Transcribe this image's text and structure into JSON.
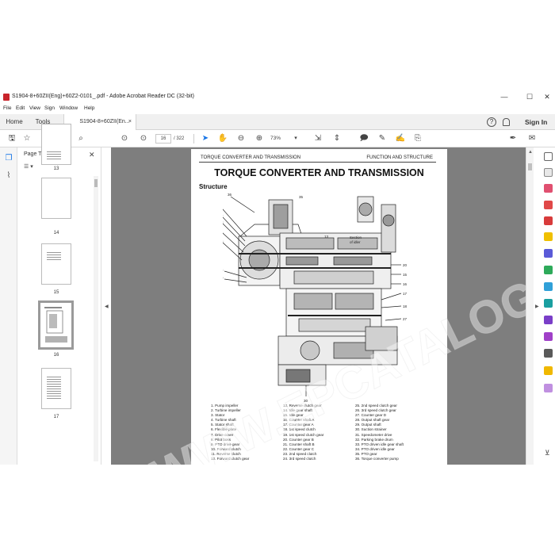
{
  "window": {
    "title": "S1904-8+60ZII(Eng)+60Z2-0101_.pdf - Adobe Acrobat Reader DC (32-bit)",
    "minimize": "—",
    "maximize": "☐",
    "close": "✕"
  },
  "menu": [
    "File",
    "Edit",
    "View",
    "Sign",
    "Window",
    "Help"
  ],
  "tabs": {
    "home": "Home",
    "tools": "Tools",
    "doc": "S1904-8+60ZII(En...",
    "doc_close": "×"
  },
  "header_right": {
    "help": "?",
    "signin": "Sign In"
  },
  "toolbar": {
    "page_current": "16",
    "page_total": "/ 322",
    "zoom": "73%"
  },
  "thumbnails": {
    "title": "Page Thumbnails",
    "close": "✕",
    "options": "☰ ▾",
    "pages": [
      {
        "num": "13"
      },
      {
        "num": "14"
      },
      {
        "num": "15"
      },
      {
        "num": "16"
      },
      {
        "num": "17"
      }
    ]
  },
  "document": {
    "header_left": "TORQUE CONVERTER AND TRANSMISSION",
    "header_right": "FUNCTION AND STRUCTURE",
    "title": "TORQUE CONVERTER AND TRANSMISSION",
    "section": "Structure",
    "section_label": "Section\nof idler",
    "legend": [
      [
        "1. Pump impeller",
        "2. Turbine impeller",
        "3. Stator",
        "4. Turbine shaft",
        "5. Stator shaft",
        "6. Flexible plate",
        "7. Drive cover",
        "8. Pilot boss",
        "9. PTO drive gear",
        "10. Forward clutch",
        "11. Reverse clutch",
        "12. Forward clutch gear"
      ],
      [
        "13. Reverse clutch gear",
        "14. Idle gear shaft",
        "15. Idle gear",
        "16. Counter shaft A",
        "17. Counter gear A",
        "18. 1st speed clutch",
        "19. 1st speed clutch gear",
        "20. Counter gear B",
        "21. Counter shaft B",
        "22. Counter gear C",
        "23. 2nd speed clutch",
        "24. 3rd speed clutch"
      ],
      [
        "25. 2nd speed clutch gear",
        "26. 3rd speed clutch gear",
        "27. Counter gear D",
        "28. Output shaft gear",
        "29. Output shaft",
        "30. Suction strainer",
        "31. Speedometer drive",
        "32. Parking brake drum",
        "33. PTO driven idle gear shaft",
        "34. PTO driven idle gear",
        "35. PTO gear",
        "36. Torque converter pump"
      ]
    ]
  },
  "watermark": "WWW.EPCATALOGUE.COM",
  "colors": {
    "viewer_bg": "#7e7e7e",
    "accent_blue": "#1473e6",
    "acrobat_red": "#c8242b"
  }
}
